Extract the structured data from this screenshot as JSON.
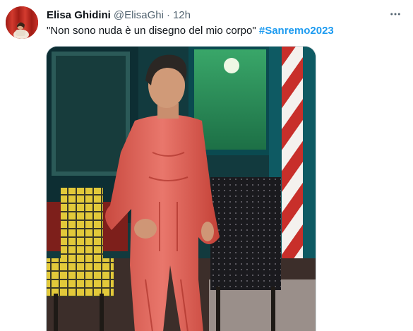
{
  "tweet": {
    "author": {
      "display_name": "Elisa Ghidini",
      "handle": "@ElisaGhi",
      "avatar_icon": "profile-photo-icon"
    },
    "separator": "·",
    "timestamp": "12h",
    "text": "\"Non sono nuda è un disegno del mio corpo\"",
    "hashtag": "#Sanremo2023",
    "more_icon": "more-horizontal-icon",
    "colors": {
      "hashtag": "#1d9bf0",
      "secondary_text": "#536471",
      "primary_text": "#0f1419"
    }
  }
}
